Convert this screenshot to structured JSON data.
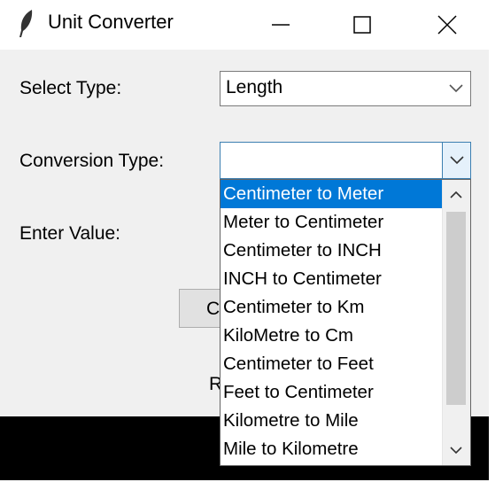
{
  "window": {
    "title": "Unit Converter",
    "controls": [
      "minimize",
      "maximize",
      "close"
    ]
  },
  "form": {
    "select_type_label": "Select Type:",
    "select_type_value": "Length",
    "conversion_type_label": "Conversion Type:",
    "conversion_type_value": "",
    "enter_value_label": "Enter Value:",
    "convert_button_partial": "C",
    "result_label_partial": "R"
  },
  "dropdown": {
    "options": [
      "Centimeter to Meter",
      "Meter to Centimeter",
      "Centimeter to INCH",
      "INCH to Centimeter",
      "Centimeter to Km",
      "KiloMetre to Cm",
      "Centimeter to Feet",
      "Feet to Centimeter",
      "Kilometre to Mile",
      "Mile to Kilometre"
    ],
    "selected_index": 0
  },
  "colors": {
    "selection": "#0078d7",
    "client_bg": "#f0f0f0",
    "combo_focus": "#3c7fb1"
  }
}
